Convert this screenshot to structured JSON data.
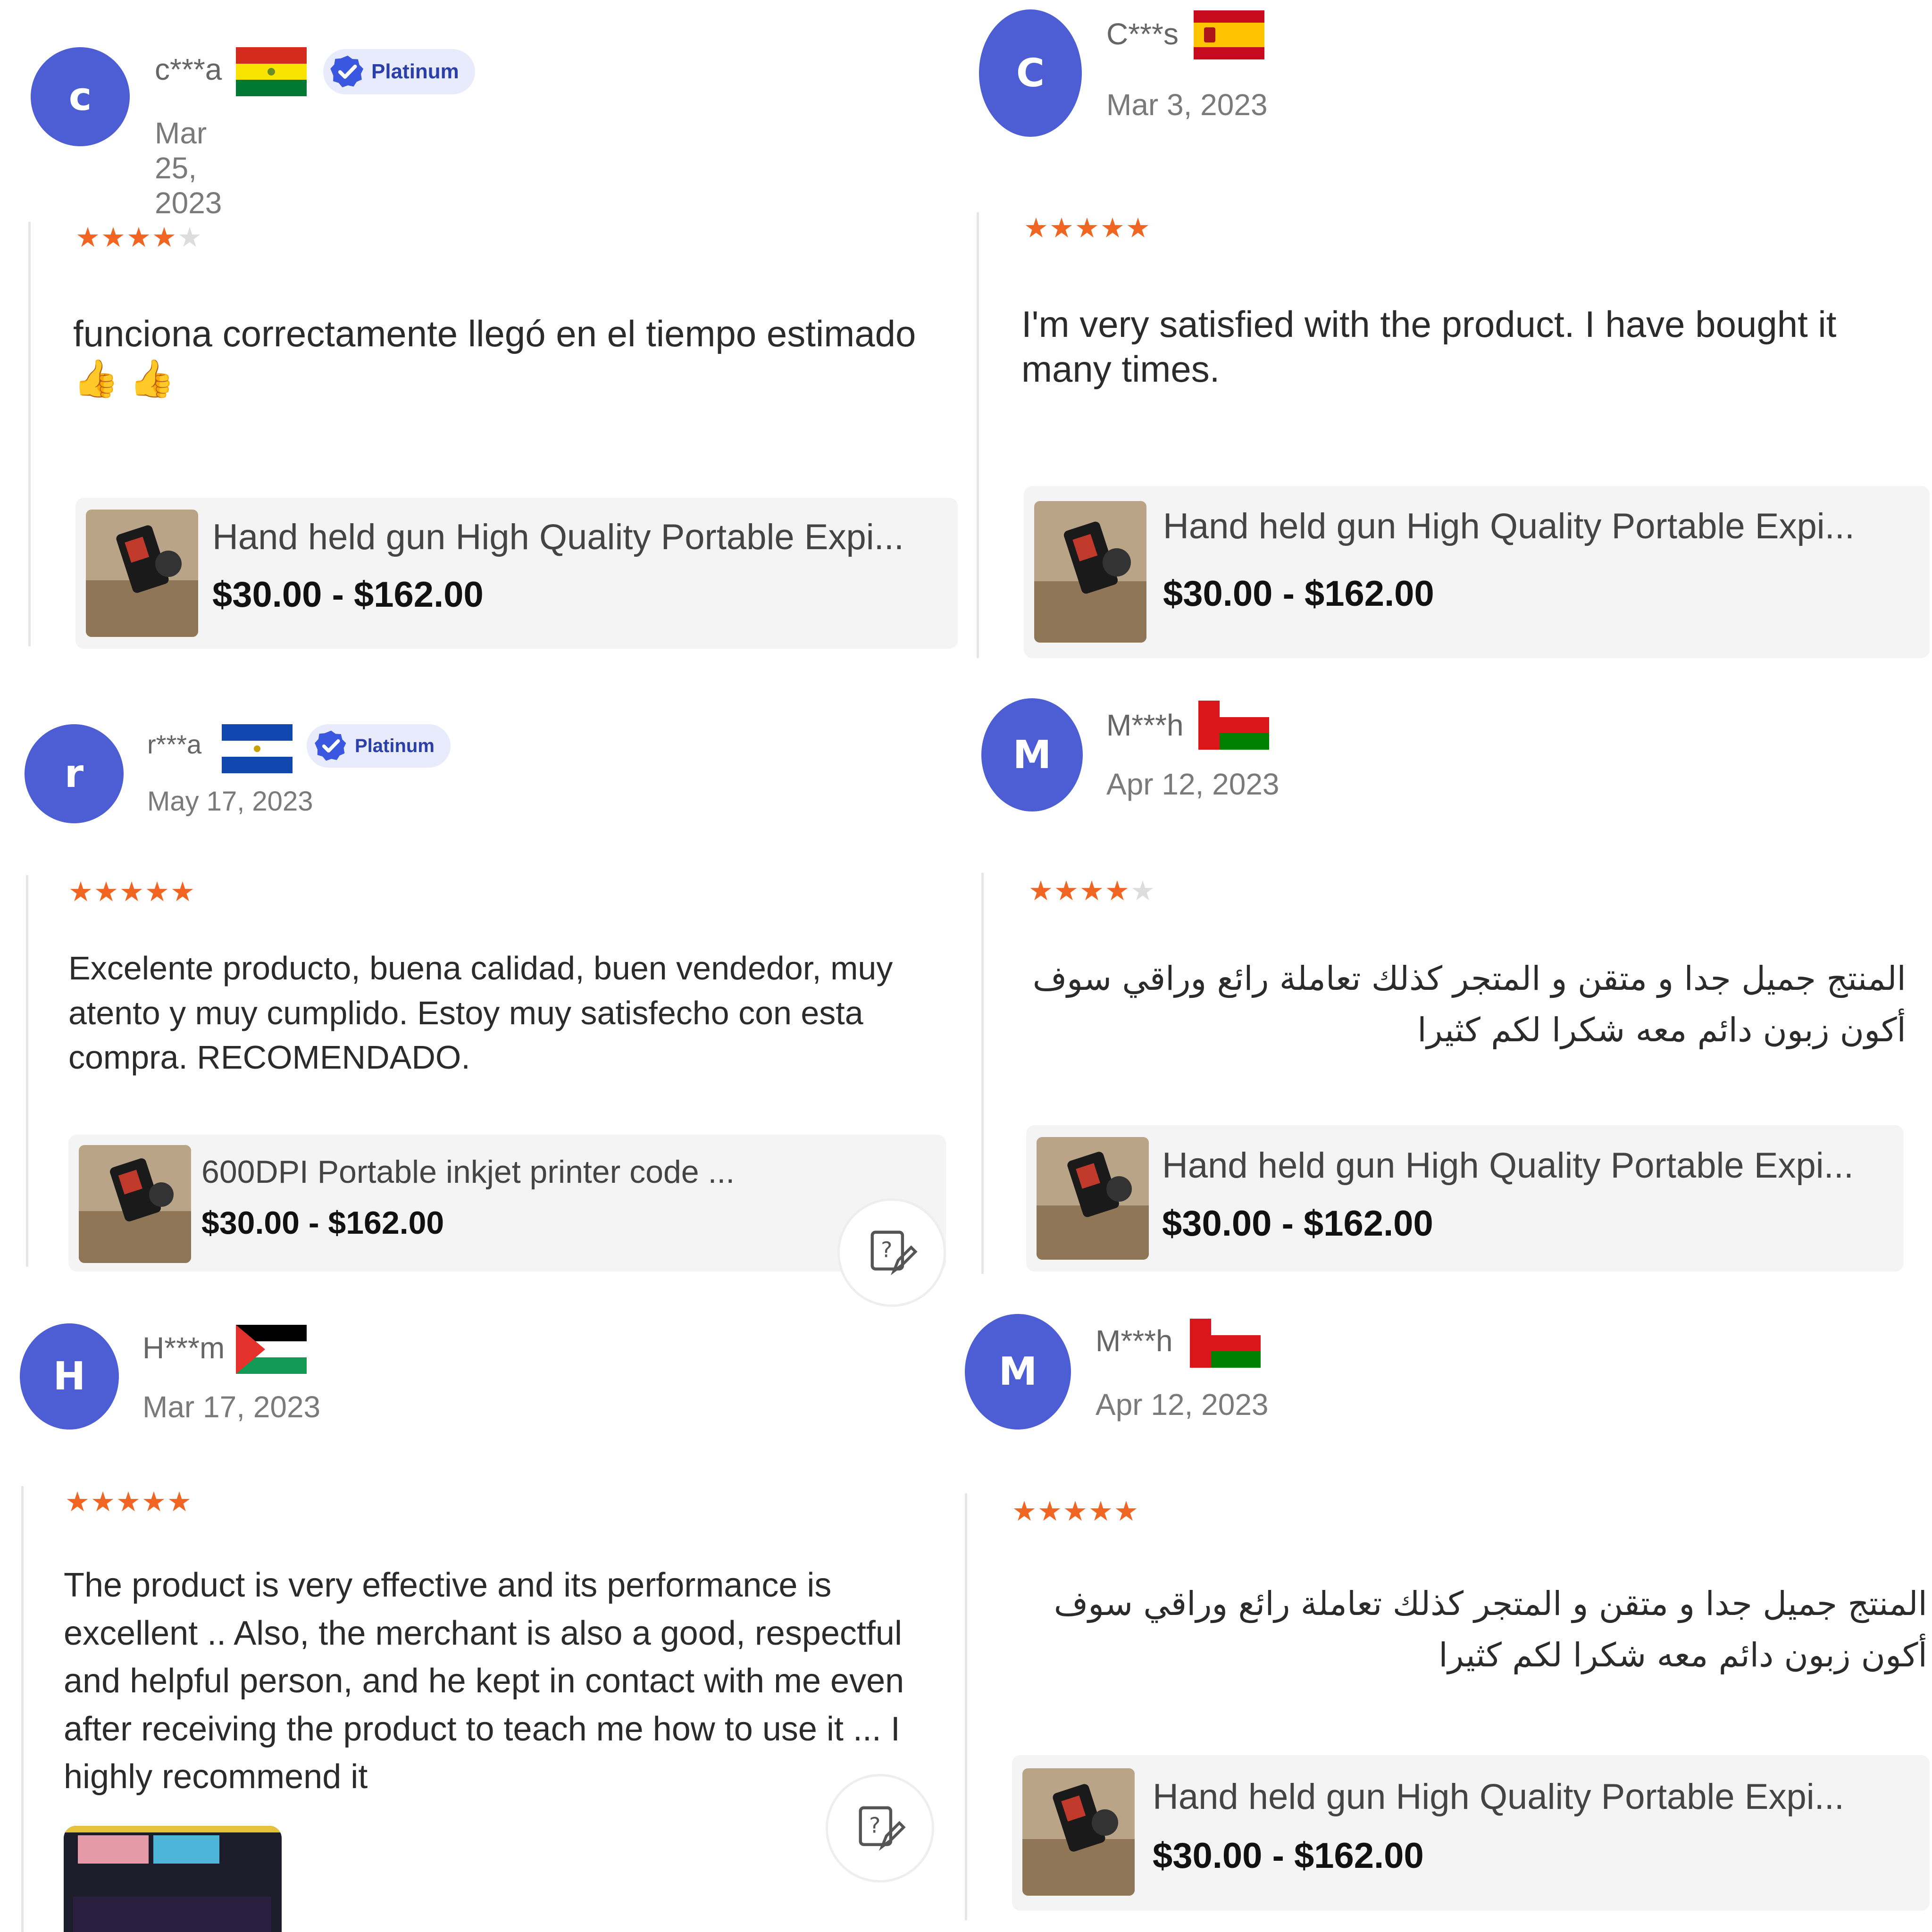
{
  "reviews": [
    {
      "initial": "c",
      "name": "c***a",
      "flag": "bolivia",
      "badge": "Platinum",
      "date": "Mar 25, 2023",
      "rating": 4,
      "text": "funciona correctamente llegó en el tiempo estimado 👍 👍",
      "product": {
        "title": "Hand held gun High Quality Portable Expi...",
        "price": "$30.00 - $162.00"
      }
    },
    {
      "initial": "C",
      "name": "C***s",
      "flag": "spain",
      "date": "Mar 3, 2023",
      "rating": 5,
      "text": "I'm very satisfied with the product. I have bought it many times.",
      "product": {
        "title": "Hand held gun High Quality Portable Expi...",
        "price": "$30.00 - $162.00"
      }
    },
    {
      "initial": "r",
      "name": "r***a",
      "flag": "el-salvador",
      "badge": "Platinum",
      "date": "May 17, 2023",
      "rating": 5,
      "text": "Excelente producto, buena calidad, buen vendedor, muy atento y muy cumplido. Estoy muy satisfecho con esta compra. RECOMENDADO.",
      "product": {
        "title": "600DPI Portable inkjet printer code ...",
        "price": "$30.00 - $162.00"
      }
    },
    {
      "initial": "M",
      "name": "M***h",
      "flag": "oman",
      "date": "Apr 12, 2023",
      "rating": 4,
      "text": "المنتج جميل جدا و متقن و المتجر كذلك تعاملة رائع وراقي سوف أكون زبون دائم معه شكرا لكم كثيرا",
      "product": {
        "title": "Hand held gun High Quality Portable Expi...",
        "price": "$30.00 - $162.00"
      }
    },
    {
      "initial": "H",
      "name": "H***m",
      "flag": "palestine",
      "date": "Mar 17, 2023",
      "rating": 5,
      "text": "The product is very effective and its performance is excellent .. Also, the merchant is also a good, respectful and helpful person, and he kept in contact with me even after receiving the product to teach me how to use it ... I highly recommend it"
    },
    {
      "initial": "M",
      "name": "M***h",
      "flag": "oman",
      "date": "Apr 12, 2023",
      "rating": 5,
      "text": "المنتج جميل جدا و متقن و المتجر كذلك تعاملة رائع وراقي سوف أكون زبون دائم معه شكرا لكم كثيرا",
      "product": {
        "title": "Hand held gun High Quality Portable Expi...",
        "price": "$30.00 - $162.00"
      }
    }
  ],
  "colors": {
    "avatar": "#4d5ed4",
    "star_active": "#f06522",
    "star_inactive": "#dddddd",
    "badge_bg": "#e7ebfb",
    "badge_text": "#2a3fa8"
  },
  "icons": {
    "badge": "verified-check-icon",
    "help": "question-edit-icon",
    "star": "star-icon"
  }
}
